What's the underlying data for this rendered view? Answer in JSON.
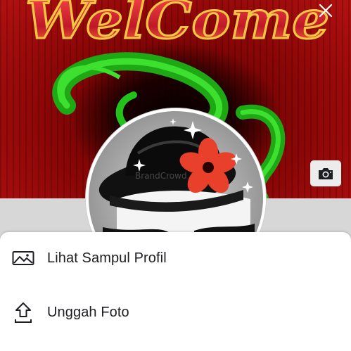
{
  "cover": {
    "banner_text": "WelCome",
    "watermark_text": "BrandCrowd"
  },
  "icons": {
    "close": "close-icon",
    "camera": "camera-icon",
    "view_cover": "image-icon",
    "upload": "upload-icon"
  },
  "menu": {
    "items": [
      {
        "label": "Lihat Sampul Profil",
        "icon": "image-icon"
      },
      {
        "label": "Unggah Foto",
        "icon": "upload-icon"
      }
    ]
  },
  "colors": {
    "sheet_background": "#ffffff",
    "text_primary": "#1c1e21",
    "cover_red": "#8a0606",
    "cover_green": "#22c21a",
    "banner_fill": "#c0182a",
    "banner_outline": "#f2c542"
  }
}
